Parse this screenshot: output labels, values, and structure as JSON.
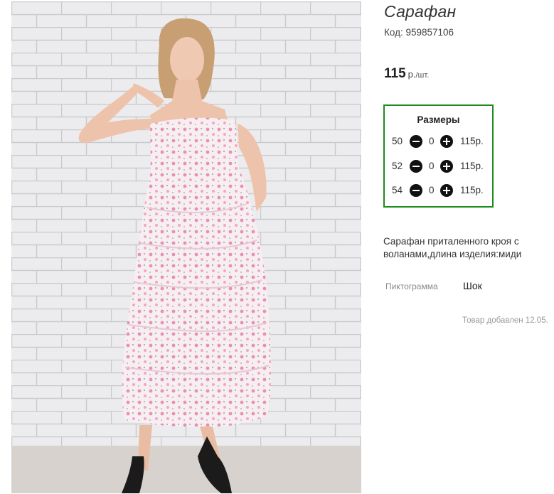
{
  "product": {
    "title": "Сарафан",
    "code": "Код: 959857106",
    "price": "115",
    "price_currency": "р.",
    "price_unit": "/шт.",
    "image_alt": "woman-in-pink-floral-tiered-dress"
  },
  "sizes": {
    "heading": "Размеры",
    "rows": [
      {
        "size": "50",
        "qty": "0",
        "price": "115р."
      },
      {
        "size": "52",
        "qty": "0",
        "price": "115р."
      },
      {
        "size": "54",
        "qty": "0",
        "price": "115р."
      }
    ]
  },
  "description": "Сарафан приталенного кроя с воланами,длина изделия:миди",
  "attributes": {
    "pictogram_label": "Пиктограмма",
    "pictogram_value": "Шок"
  },
  "added": "Товар добавлен 12.05.",
  "colors": {
    "size_border": "#1c8c1c",
    "button": "#111111"
  }
}
